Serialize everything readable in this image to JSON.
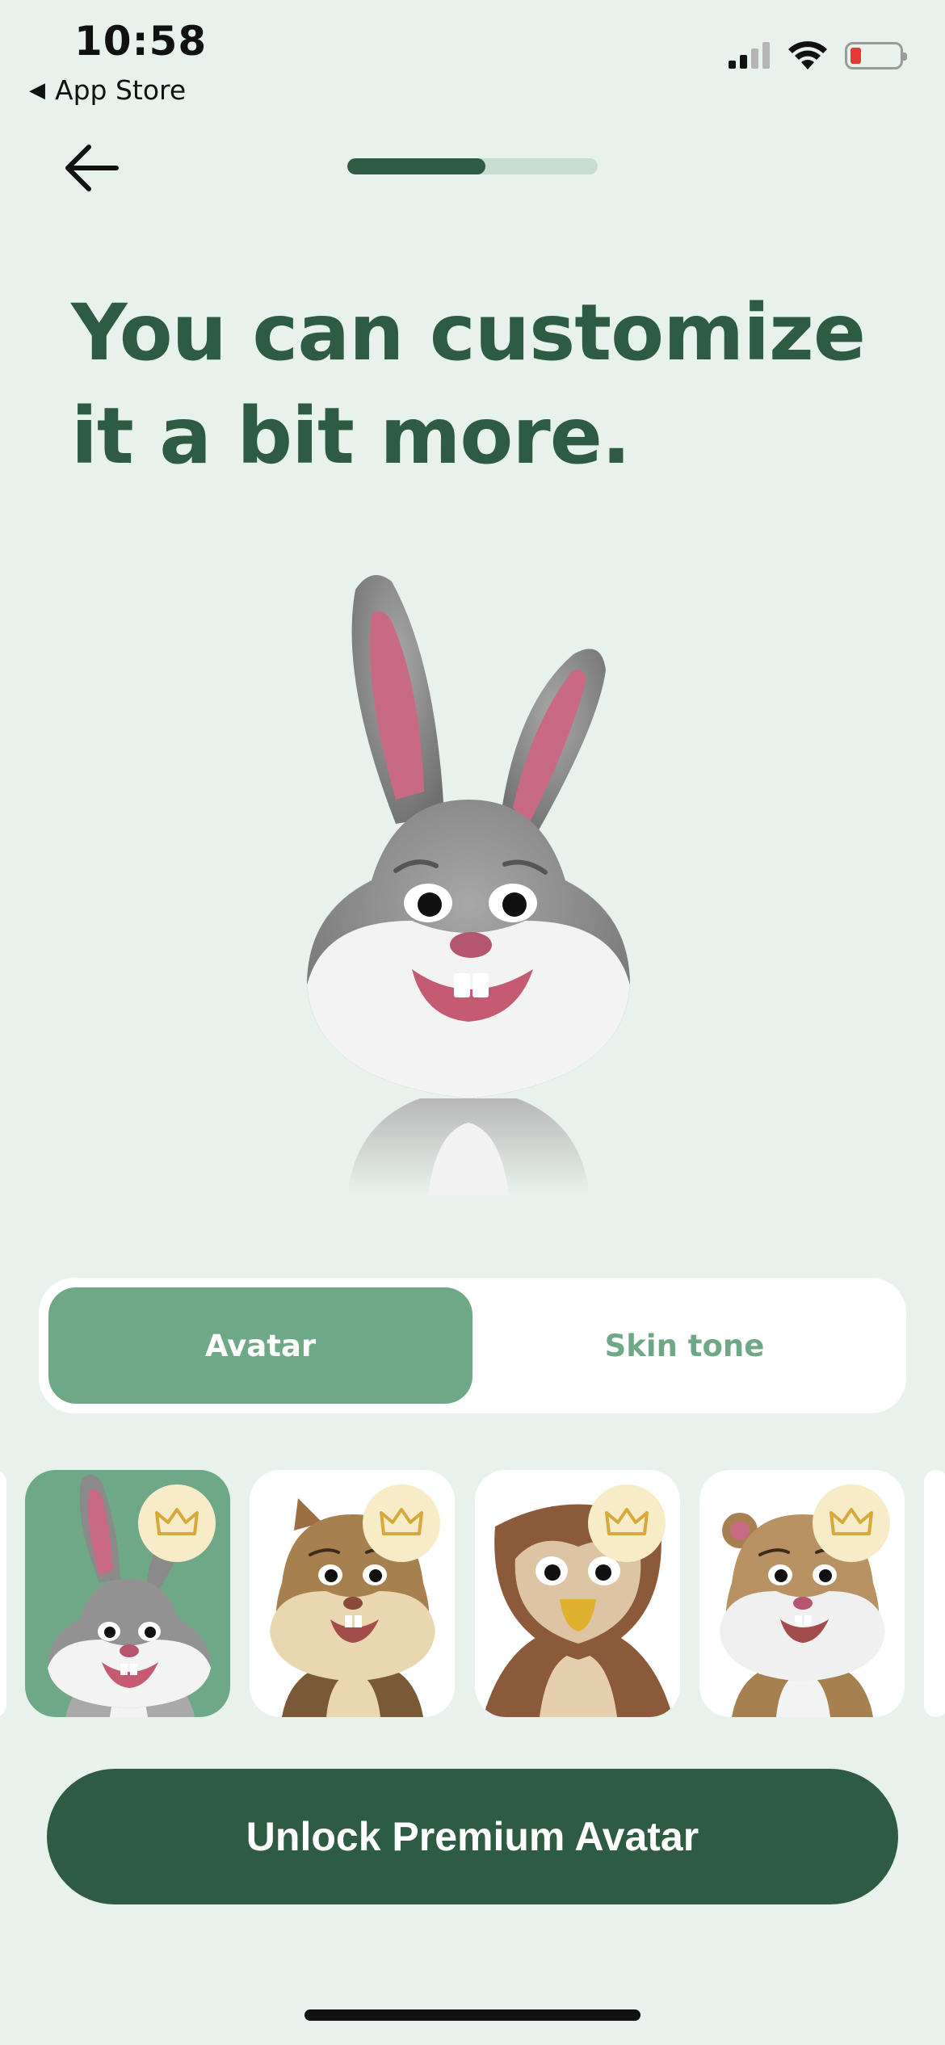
{
  "status_bar": {
    "time": "10:58",
    "back_app": "App Store",
    "icons": [
      "signal-icon",
      "wifi-icon",
      "battery-icon"
    ],
    "battery_level": 0.15
  },
  "nav": {
    "back_icon": "arrow-left-icon",
    "progress": 0.55
  },
  "title": "You can customize it a bit more.",
  "segment": {
    "active": "Avatar",
    "inactive": "Skin tone"
  },
  "avatars": [
    {
      "name": "bunny",
      "selected": true,
      "premium": true
    },
    {
      "name": "chipmunk",
      "selected": false,
      "premium": true
    },
    {
      "name": "owl",
      "selected": false,
      "premium": true
    },
    {
      "name": "hamster",
      "selected": false,
      "premium": true
    }
  ],
  "cta_label": "Unlock Premium Avatar",
  "colors": {
    "background": "#e8f2ec",
    "primary": "#2e5c43",
    "accent": "#6fa886",
    "crown_bg": "#f7ebc8",
    "crown": "#d6a93a"
  }
}
